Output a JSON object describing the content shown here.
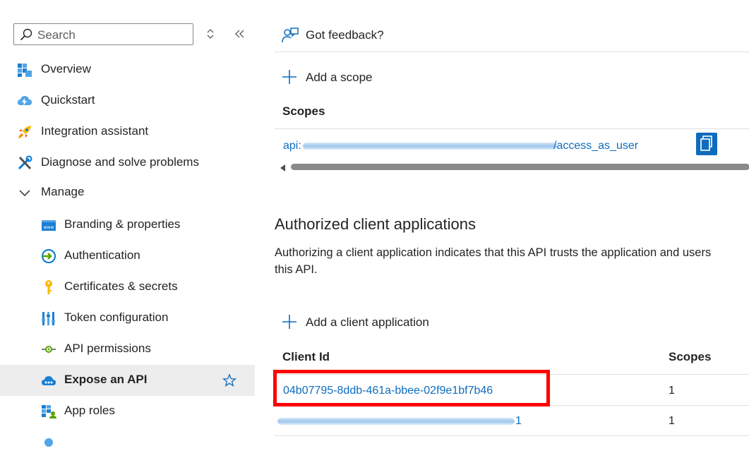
{
  "sidebar": {
    "search_placeholder": "Search",
    "items": [
      {
        "label": "Overview",
        "icon": "grid-cube-icon"
      },
      {
        "label": "Quickstart",
        "icon": "cloud-lightning-icon"
      },
      {
        "label": "Integration assistant",
        "icon": "rocket-icon"
      },
      {
        "label": "Diagnose and solve problems",
        "icon": "tools-icon"
      },
      {
        "label": "Manage",
        "icon": "chevron-down-icon"
      },
      {
        "label": "Branding & properties",
        "icon": "www-icon"
      },
      {
        "label": "Authentication",
        "icon": "auth-arrow-icon"
      },
      {
        "label": "Certificates & secrets",
        "icon": "key-icon"
      },
      {
        "label": "Token configuration",
        "icon": "token-bars-icon"
      },
      {
        "label": "API permissions",
        "icon": "api-permissions-icon"
      },
      {
        "label": "Expose an API",
        "icon": "cloud-api-icon"
      },
      {
        "label": "App roles",
        "icon": "app-roles-icon"
      }
    ]
  },
  "main": {
    "feedback_label": "Got feedback?",
    "add_scope_label": "Add a scope",
    "scopes_header": "Scopes",
    "scope_prefix": "api:",
    "scope_suffix": "/access_as_user",
    "section_title": "Authorized client applications",
    "description_line1": "Authorizing a client application indicates that this API trusts the application and users",
    "description_line2": "this API.",
    "add_client_label": "Add a client application",
    "client_table": {
      "headers": [
        "Client Id",
        "Scopes"
      ],
      "rows": [
        {
          "client_id": "04b07795-8ddb-461a-bbee-02f9e1bf7b46",
          "scopes": "1"
        },
        {
          "client_id": "1",
          "scopes": "1"
        }
      ]
    }
  },
  "colors": {
    "link": "#0f6cbd",
    "highlight": "#ff0000",
    "active_bg": "#ededed"
  }
}
